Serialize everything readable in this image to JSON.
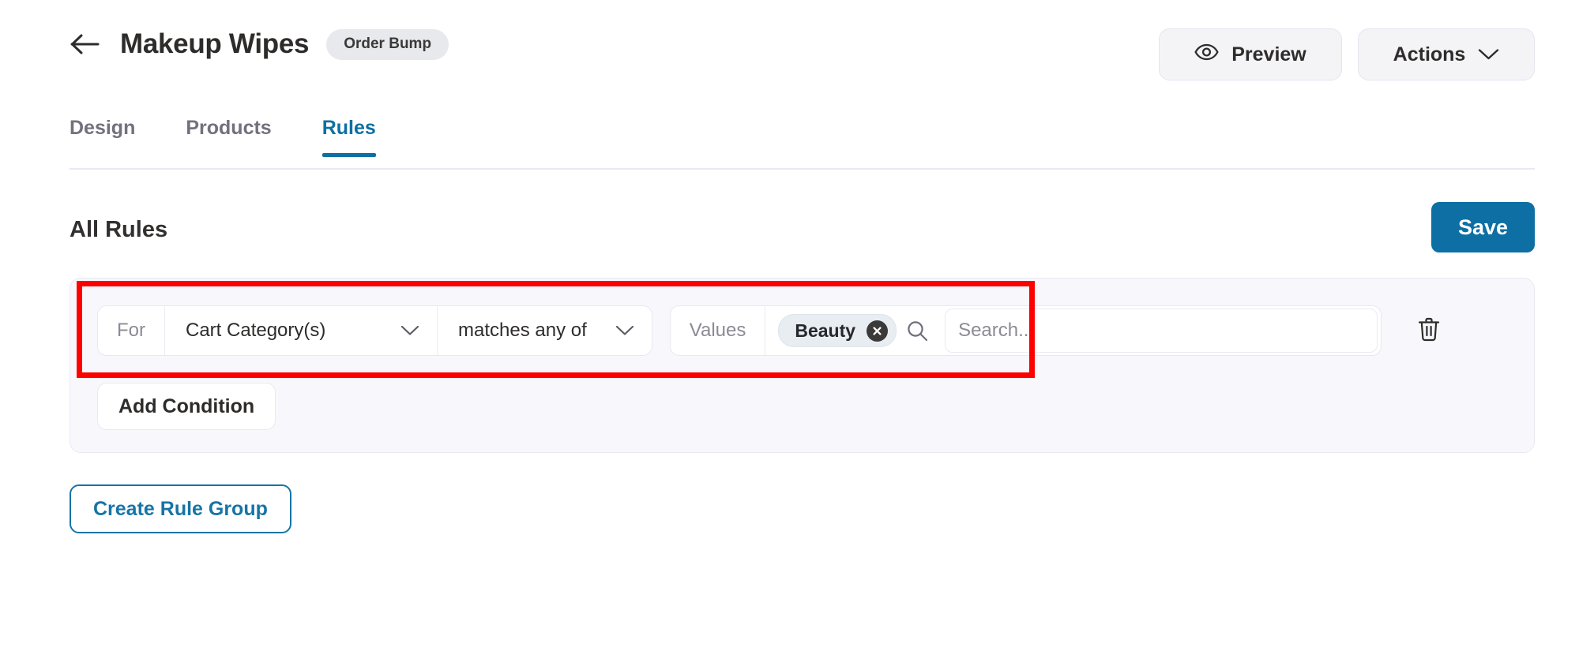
{
  "header": {
    "back_icon": "arrow-left-icon",
    "title": "Makeup Wipes",
    "badge": "Order Bump",
    "preview_label": "Preview",
    "preview_icon": "eye-icon",
    "actions_label": "Actions",
    "actions_icon": "chevron-down-icon"
  },
  "tabs": [
    {
      "label": "Design",
      "active": false
    },
    {
      "label": "Products",
      "active": false
    },
    {
      "label": "Rules",
      "active": true
    }
  ],
  "section": {
    "title": "All Rules",
    "save_label": "Save"
  },
  "rule_group": {
    "condition": {
      "for_label": "For",
      "field_value": "Cart Category(s)",
      "field_chevron_icon": "chevron-down-icon",
      "operator_value": "matches any of",
      "operator_chevron_icon": "chevron-down-icon",
      "values_label": "Values",
      "chips": [
        {
          "label": "Beauty",
          "remove_icon": "close-circle-icon"
        }
      ],
      "search_icon": "search-icon",
      "search_value": "",
      "search_placeholder": "Search...",
      "delete_icon": "trash-icon"
    },
    "add_condition_label": "Add Condition"
  },
  "create_rule_group_label": "Create Rule Group",
  "colors": {
    "accent_blue": "#0d6fa3",
    "annotation_red": "#fe0000",
    "card_bg": "#f8f8fc",
    "chip_bg": "#e7edf1",
    "badge_bg": "#e7e9ed"
  }
}
